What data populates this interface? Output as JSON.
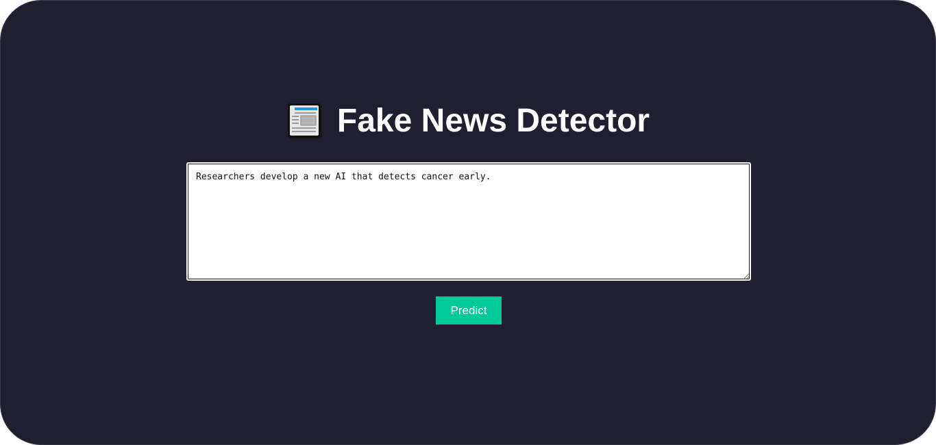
{
  "header": {
    "icon": "newspaper-icon",
    "title": "Fake News Detector"
  },
  "form": {
    "news_text": "Researchers develop a new AI that detects cancer early.",
    "predict_label": "Predict"
  },
  "colors": {
    "background": "#201f30",
    "button": "#00c896",
    "text": "#ffffff"
  }
}
